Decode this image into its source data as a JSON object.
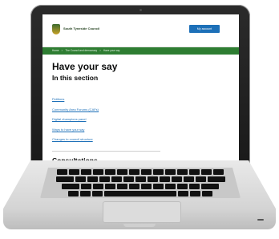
{
  "header": {
    "council_name": "South Tyneside Council",
    "account_button_label": "My account"
  },
  "breadcrumb": {
    "items": [
      "Home",
      "The Council and democracy",
      "Have your say"
    ],
    "separator": ">"
  },
  "main": {
    "title": "Have your say",
    "section_heading": "In this section",
    "links": [
      "Petitions",
      "Community Area Forums (CAFs)",
      "Digital champions panel",
      "Ways to have your say",
      "Changes to council structure"
    ],
    "consultations_heading": "Consultations"
  },
  "colors": {
    "brand_green": "#2e7d32",
    "link_blue": "#1d70b8",
    "button_blue": "#1d70b8"
  },
  "icons": {
    "crest": "council-crest-icon"
  }
}
